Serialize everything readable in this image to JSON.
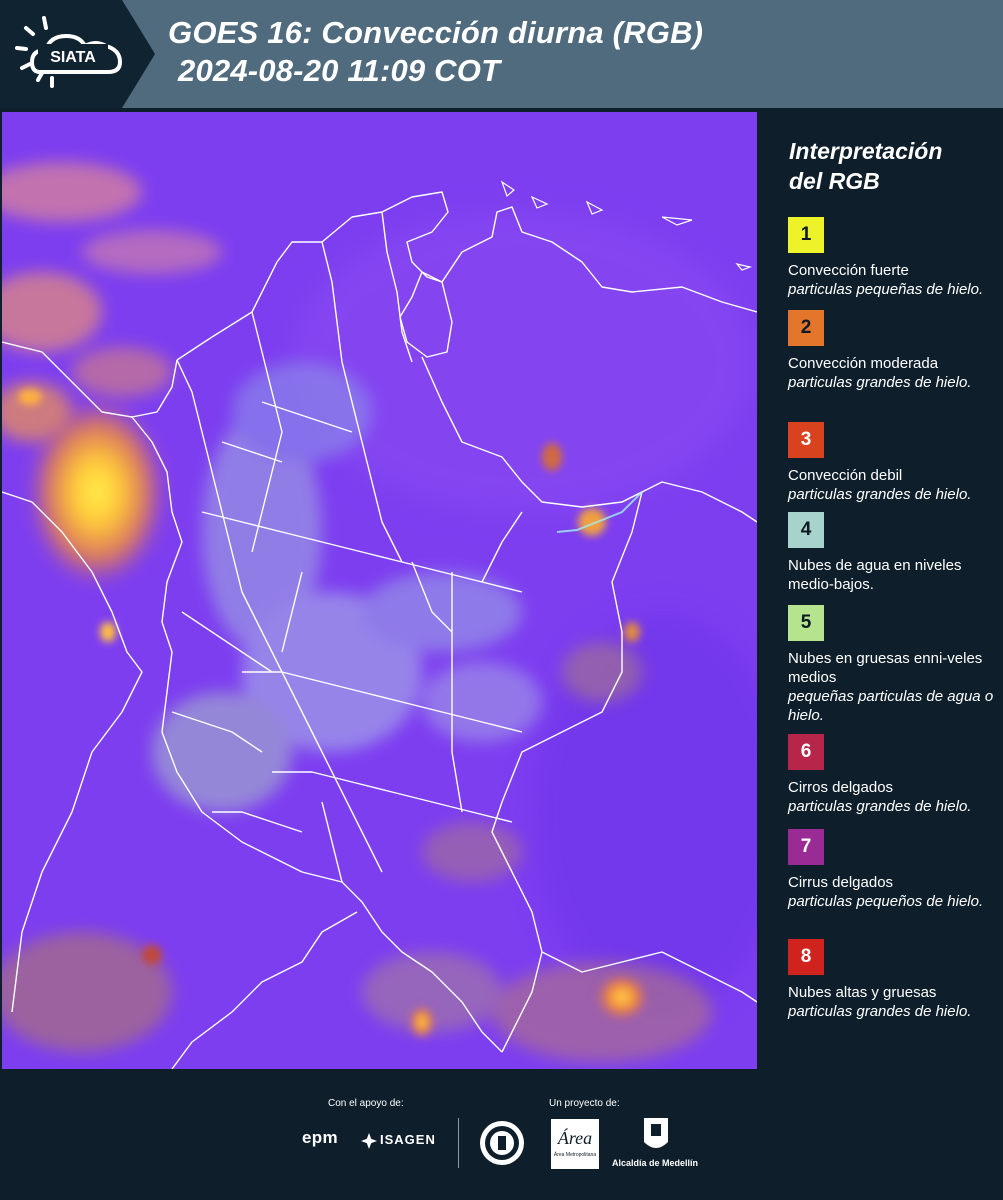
{
  "header": {
    "logo_text": "SIATA",
    "title_line1": "GOES 16: Convección diurna (RGB)",
    "title_line2": "2024-08-20 11:09 COT"
  },
  "legend": {
    "title_line1": "Interpretación",
    "title_line2": "del RGB",
    "items": [
      {
        "number": "1",
        "color": "#eef229",
        "label": "Convección fuerte",
        "desc": "particulas pequeñas de hielo."
      },
      {
        "number": "2",
        "color": "#e3762b",
        "label": "Convección moderada",
        "desc": "particulas grandes de hielo."
      },
      {
        "number": "3",
        "color": "#d9421f",
        "label": "Convección debil",
        "desc": "particulas grandes de hielo."
      },
      {
        "number": "4",
        "color": "#a8d2cc",
        "label": "Nubes de agua en niveles medio-bajos.",
        "desc": ""
      },
      {
        "number": "5",
        "color": "#b5e38e",
        "label": "Nubes en gruesas enni-veles medios",
        "desc": "pequeñas particulas de agua o hielo."
      },
      {
        "number": "6",
        "color": "#b7254a",
        "label": "Cirros delgados",
        "desc": "particulas grandes de hielo."
      },
      {
        "number": "7",
        "color": "#9a2b95",
        "label": "Cirrus delgados",
        "desc": "particulas pequeños de hielo."
      },
      {
        "number": "8",
        "color": "#d0231e",
        "label": "Nubes altas y gruesas",
        "desc": "particulas grandes de hielo."
      }
    ]
  },
  "footer": {
    "support_label": "Con el apoyo de:",
    "project_label": "Un proyecto de:",
    "sponsor1": "epm",
    "sponsor2": "ISAGEN",
    "partner1": "Área Metropolitana",
    "partner2": "Alcaldía de Medellín"
  }
}
